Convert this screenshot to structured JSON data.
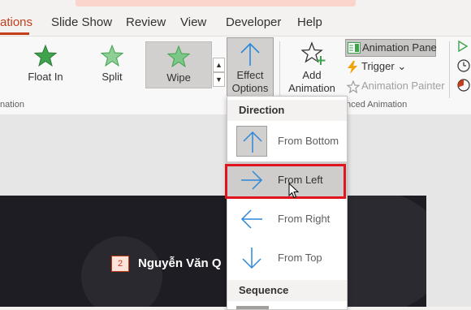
{
  "tabs": [
    "ations",
    "Slide Show",
    "Review",
    "View",
    "Developer",
    "Help"
  ],
  "gallery": [
    {
      "label": "Float In",
      "icon": "star-green-icon"
    },
    {
      "label": "Split",
      "icon": "star-green-icon"
    },
    {
      "label": "Wipe",
      "icon": "star-green-icon",
      "selected": true
    }
  ],
  "group_labels": {
    "animation": "nation",
    "advanced": "nced Animation"
  },
  "effect_options": {
    "line1": "Effect",
    "line2": "Options",
    "chevron": "⌄"
  },
  "add_animation": {
    "line1": "Add",
    "line2": "Animation",
    "chevron": "⌄"
  },
  "commands": {
    "animation_pane": "Animation Pane",
    "trigger": "Trigger",
    "trigger_chevron": "⌄",
    "animation_painter": "Animation Painter"
  },
  "dropdown": {
    "direction_header": "Direction",
    "items": [
      {
        "label": "From Bottom",
        "icon": "arrow-up-icon"
      },
      {
        "label": "From Left",
        "icon": "arrow-right-icon"
      },
      {
        "label": "From Right",
        "icon": "arrow-left-icon"
      },
      {
        "label": "From Top",
        "icon": "arrow-down-icon"
      }
    ],
    "sequence_header": "Sequence"
  },
  "slide": {
    "badge": "2",
    "name": "Nguyễn Văn Q"
  },
  "colors": {
    "accent": "#c43e1c",
    "highlight": "#e0141e",
    "star_green": "#3fa34d",
    "arrow_blue": "#2b88d8",
    "slide_bg": "#1e1d24"
  }
}
